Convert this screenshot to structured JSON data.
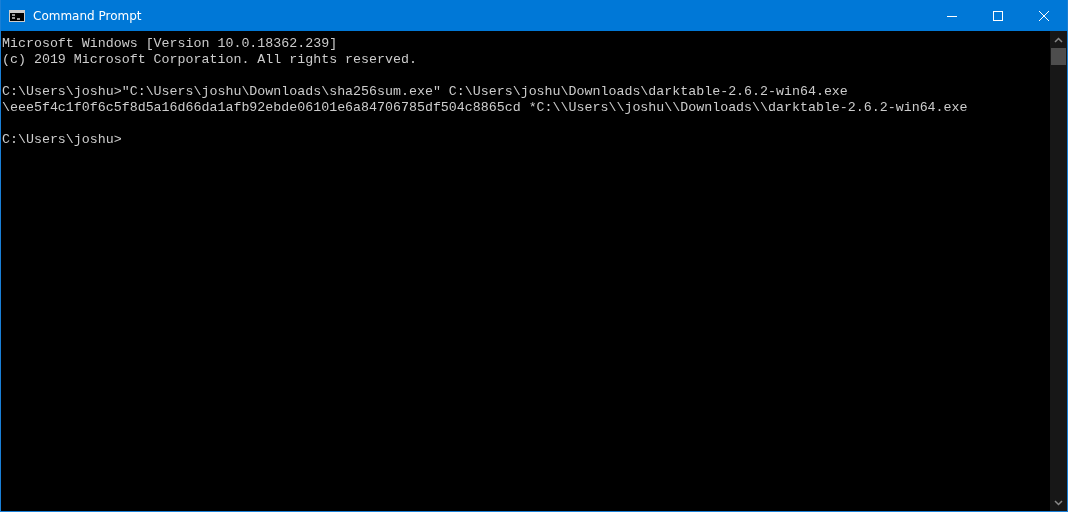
{
  "window": {
    "title": "Command Prompt"
  },
  "console": {
    "blocks": [
      [
        "Microsoft Windows [Version 10.0.18362.239]",
        "(c) 2019 Microsoft Corporation. All rights reserved."
      ],
      [
        "C:\\Users\\joshu>\"C:\\Users\\joshu\\Downloads\\sha256sum.exe\" C:\\Users\\joshu\\Downloads\\darktable-2.6.2-win64.exe",
        "\\eee5f4c1f0f6c5f8d5a16d66da1afb92ebde06101e6a84706785df504c8865cd *C:\\\\Users\\\\joshu\\\\Downloads\\\\darktable-2.6.2-win64.exe"
      ],
      [
        "C:\\Users\\joshu>"
      ]
    ]
  }
}
